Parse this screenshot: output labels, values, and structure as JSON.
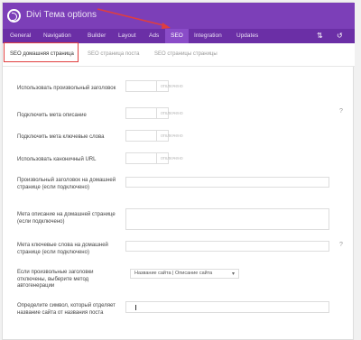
{
  "app": {
    "title": "Divi Тема options"
  },
  "nav": {
    "items": [
      "General",
      "Navigation",
      "Builder",
      "Layout",
      "Ads",
      "SEO",
      "Integration",
      "Updates"
    ],
    "active": "SEO",
    "icons": [
      "sort-icon",
      "reset-icon"
    ]
  },
  "subtabs": {
    "items": [
      "SEO домашняя страница",
      "SEO страница поста",
      "SEO страницы страницы"
    ],
    "active_index": 0
  },
  "settings": {
    "rows": [
      {
        "label": "Использовать произвольный заголовок",
        "control": "toggle",
        "value": "отключено"
      },
      {
        "label": "Подключить мета описание",
        "control": "toggle",
        "value": "отключено"
      },
      {
        "label": "Подключить мета ключевые слова",
        "control": "toggle",
        "value": "отключено"
      },
      {
        "label": "Использовать каноничный URL",
        "control": "toggle",
        "value": "отключено"
      },
      {
        "label": "Произвольный заголовок на домашней странице (если подключено)",
        "control": "input",
        "value": ""
      },
      {
        "label": "Мета описание на домашней странице (если подключено)",
        "control": "textarea",
        "value": ""
      },
      {
        "label": "Мета ключевые слова на домашней странице (если подключено)",
        "control": "input",
        "value": ""
      },
      {
        "label": "Если произвольные заголовки отключены, выберите метод автогенерации",
        "control": "select",
        "value": "Название сайта | Описание сайта"
      },
      {
        "label": "Определите символ, который отделяет название сайта от названия поста",
        "control": "input",
        "value": "|"
      }
    ]
  },
  "colors": {
    "header": "#7c3fb8",
    "navbar": "#6b2fa6",
    "active_tab": "#8a4cc8",
    "annotation": "#e03e3e"
  }
}
